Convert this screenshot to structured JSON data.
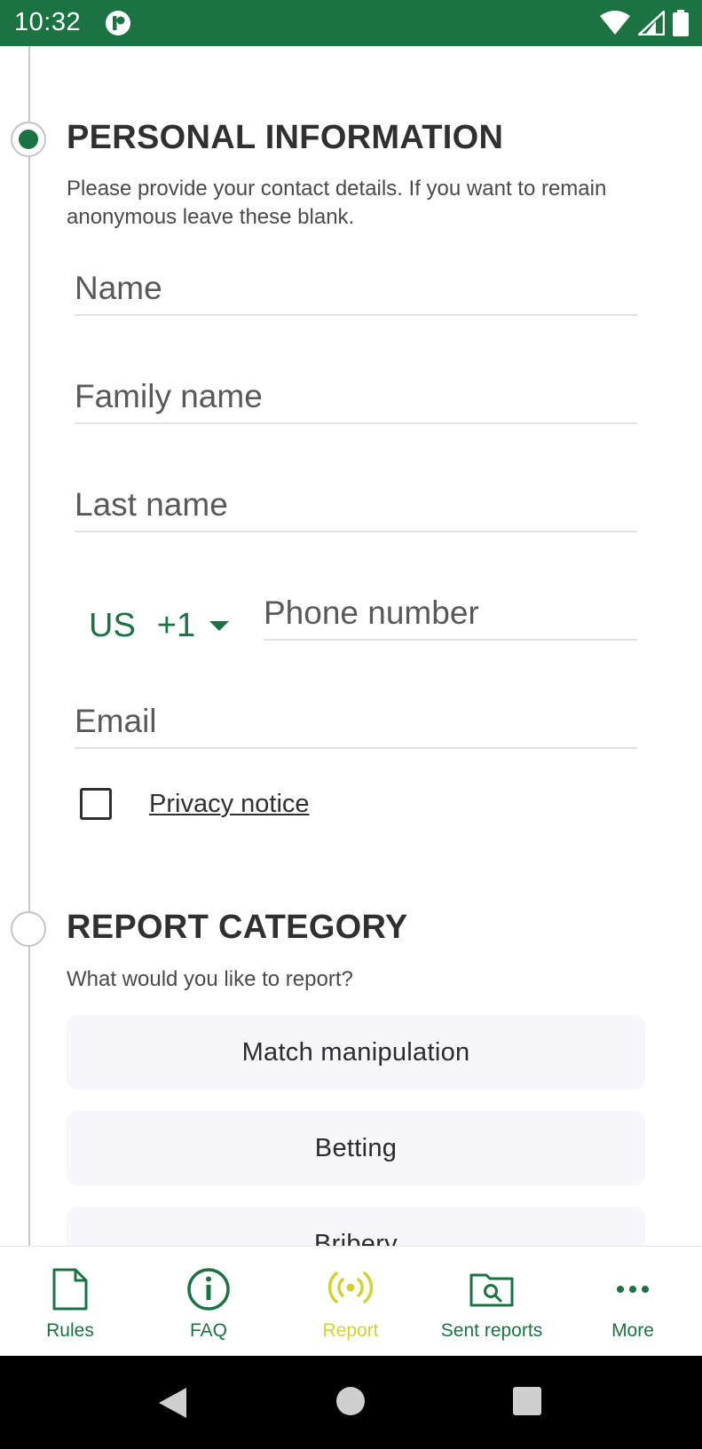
{
  "status_bar": {
    "time": "10:32",
    "background": "#1b7344",
    "icons": [
      "app-notification-icon",
      "wifi-icon",
      "signal-icon",
      "battery-icon"
    ]
  },
  "personal_info": {
    "title": "PERSONAL INFORMATION",
    "description": "Please provide your contact details. If you want to remain anonymous leave these blank.",
    "fields": {
      "name_placeholder": "Name",
      "family_name_placeholder": "Family name",
      "last_name_placeholder": "Last name",
      "phone_placeholder": "Phone number",
      "email_placeholder": "Email"
    },
    "country": {
      "code": "US",
      "dial": "+1"
    },
    "privacy": {
      "checked": false,
      "label": "Privacy notice"
    }
  },
  "report_category": {
    "title": "REPORT CATEGORY",
    "question": "What would you like to report?",
    "options": [
      "Match manipulation",
      "Betting",
      "Bribery"
    ]
  },
  "bottom_nav": {
    "items": [
      {
        "label": "Rules",
        "icon": "document-icon"
      },
      {
        "label": "FAQ",
        "icon": "info-icon"
      },
      {
        "label": "Report",
        "icon": "broadcast-icon"
      },
      {
        "label": "Sent reports",
        "icon": "folder-search-icon"
      },
      {
        "label": "More",
        "icon": "more-dots-icon"
      }
    ],
    "active": "Report",
    "active_color": "#d2d232",
    "color": "#1b7344"
  }
}
